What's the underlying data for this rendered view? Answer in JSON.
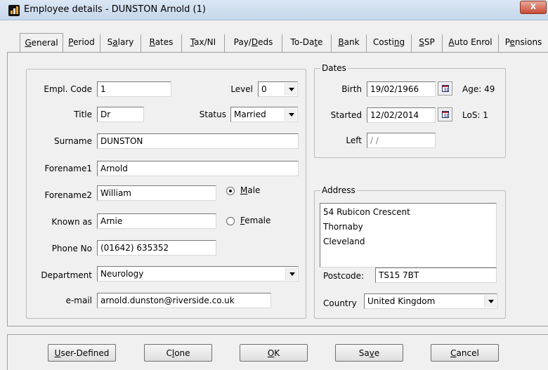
{
  "window": {
    "title": "Employee details - DUNSTON Arnold (1)",
    "close_glyph": "x"
  },
  "tabs": [
    {
      "pre": "",
      "key": "G",
      "post": "eneral"
    },
    {
      "pre": "",
      "key": "P",
      "post": "eriod"
    },
    {
      "pre": "S",
      "key": "a",
      "post": "lary"
    },
    {
      "pre": "",
      "key": "R",
      "post": "ates"
    },
    {
      "pre": "",
      "key": "T",
      "post": "ax/NI"
    },
    {
      "pre": "Pay/",
      "key": "D",
      "post": "eds"
    },
    {
      "pre": "To-Da",
      "key": "t",
      "post": "e"
    },
    {
      "pre": "",
      "key": "B",
      "post": "ank"
    },
    {
      "pre": "Costi",
      "key": "n",
      "post": "g"
    },
    {
      "pre": "",
      "key": "S",
      "post": "SP"
    },
    {
      "pre": "",
      "key": "A",
      "post": "uto Enrol"
    },
    {
      "pre": "P",
      "key": "e",
      "post": "nsions"
    }
  ],
  "general": {
    "empl_code_label": "Empl. Code",
    "empl_code": "1",
    "level_label": "Level",
    "level": "0",
    "title_label": "Title",
    "title": "Dr",
    "status_label": "Status",
    "status": "Married",
    "surname_label": "Surname",
    "surname": "DUNSTON",
    "forename1_label": "Forename1",
    "forename1": "Arnold",
    "forename2_label": "Forename2",
    "forename2": "William",
    "gender": {
      "male_key": "M",
      "male_rest": "ale",
      "female_key": "F",
      "female_rest": "emale",
      "selected": "Male"
    },
    "known_as_label": "Known as",
    "known_as": "Arnie",
    "phone_label": "Phone No",
    "phone": "(01642) 635352",
    "department_label": "Department",
    "department": "Neurology",
    "email_label": "e-mail",
    "email": "arnold.dunston@riverside.co.uk"
  },
  "dates": {
    "group_title": "Dates",
    "birth_label": "Birth",
    "birth": "19/02/1966",
    "age": "Age: 49",
    "started_label": "Started",
    "started": "12/02/2014",
    "los": "LoS: 1",
    "left_label": "Left",
    "left": " / /"
  },
  "address": {
    "group_title": "Address",
    "lines": [
      "54 Rubicon Crescent",
      "Thornaby",
      "Cleveland"
    ],
    "postcode_label": "Postcode:",
    "postcode": "TS15 7BT",
    "country_label": "Country",
    "country": "United Kingdom"
  },
  "buttons": [
    {
      "key": "U",
      "rest": "ser-Defined"
    },
    {
      "pre": "C",
      "key": "l",
      "rest": "one"
    },
    {
      "key": "O",
      "rest": "K"
    },
    {
      "pre": "Sa",
      "key": "v",
      "rest": "e"
    },
    {
      "key": "C",
      "rest": "ancel"
    }
  ]
}
